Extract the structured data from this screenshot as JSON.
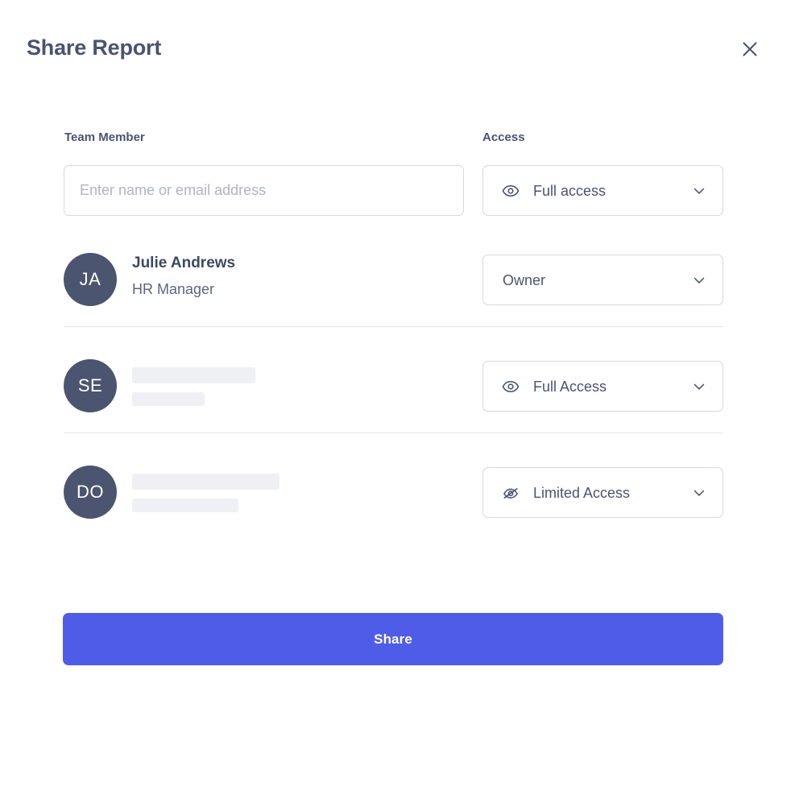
{
  "dialog": {
    "title": "Share Report",
    "close_icon": "close-icon"
  },
  "columns": {
    "member_label": "Team Member",
    "access_label": "Access"
  },
  "invite": {
    "input_value": "",
    "input_placeholder": "Enter name or email address",
    "access": {
      "value": "Full access",
      "icon": "eye-icon",
      "chevron": "chevron-down-icon"
    }
  },
  "members": [
    {
      "initials": "JA",
      "name": "Julie Andrews",
      "role": "HR Manager",
      "loading": false,
      "access": {
        "value": "Owner",
        "icon": "none",
        "chevron": "chevron-down-icon"
      }
    },
    {
      "initials": "SE",
      "name": "",
      "role": "",
      "loading": true,
      "access": {
        "value": "Full Access",
        "icon": "eye-icon",
        "chevron": "chevron-down-icon"
      }
    },
    {
      "initials": "DO",
      "name": "",
      "role": "",
      "loading": true,
      "access": {
        "value": "Limited Access",
        "icon": "eye-off-icon",
        "chevron": "chevron-down-icon"
      }
    }
  ],
  "footer": {
    "share_label": "Share"
  },
  "colors": {
    "primary": "#4f5ce8",
    "avatar": "#4b5570",
    "text_dark": "#4a5372",
    "border": "#d4d8e2",
    "placeholder": "#aeb4c6",
    "skeleton": "#eff0f3",
    "divider": "#e4e6ec"
  }
}
